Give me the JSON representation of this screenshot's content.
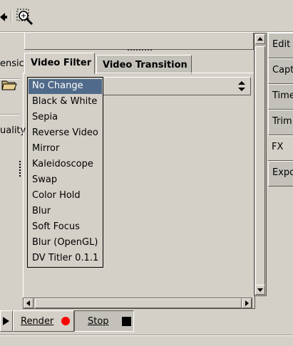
{
  "left_pane": {
    "label_top": "ensic",
    "label_bottom": "uality"
  },
  "tabs": [
    {
      "label": "Video Filter",
      "active": true
    },
    {
      "label": "Video Transition",
      "active": false
    }
  ],
  "dropdown": {
    "selected": "No Change",
    "options": [
      "No Change",
      "Black & White",
      "Sepia",
      "Reverse Video",
      "Mirror",
      "Kaleidoscope",
      "Swap",
      "Color Hold",
      "Blur",
      "Soft Focus",
      "Blur (OpenGL)",
      "DV Titler 0.1.1"
    ]
  },
  "right_tabs": [
    {
      "label": "Edit",
      "active": false
    },
    {
      "label": "Capt",
      "active": false
    },
    {
      "label": "Time",
      "active": false
    },
    {
      "label": "Trim",
      "active": false
    },
    {
      "label": "FX",
      "active": true
    },
    {
      "label": "Expo",
      "active": false
    }
  ],
  "buttons": {
    "render": "Render",
    "stop": "Stop"
  },
  "colors": {
    "window_bg": "#d4d0c8",
    "selection_bg": "#4f6a8a",
    "render_indicator": "#ff0000"
  }
}
